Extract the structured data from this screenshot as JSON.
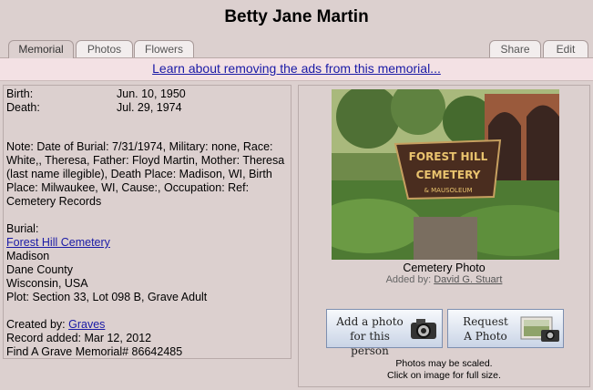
{
  "page": {
    "title": "Betty Jane Martin"
  },
  "tabs": [
    {
      "label": "Memorial"
    },
    {
      "label": "Photos"
    },
    {
      "label": "Flowers"
    },
    {
      "label": "Share"
    },
    {
      "label": "Edit"
    }
  ],
  "ad": {
    "link": "Learn about removing the ads from this memorial..."
  },
  "memorial": {
    "birth_label": "Birth:",
    "birth_date": "Jun. 10, 1950",
    "death_label": "Death:",
    "death_date": "Jul. 29, 1974",
    "note": "Note: Date of Burial: 7/31/1974, Military: none, Race: White,, Theresa, Father: Floyd Martin, Mother: Theresa (last name illegible), Death Place: Madison, WI, Birth Place: Milwaukee, WI, Cause:, Occupation: Ref: Cemetery Records",
    "burial_label": "Burial:",
    "cemetery_link": "Forest Hill Cemetery",
    "city": "Madison",
    "county": "Dane County",
    "state_country": "Wisconsin, USA",
    "plot": "Plot: Section 33, Lot 098 B, Grave Adult",
    "created_by_label": "Created by:",
    "created_by_link": "Graves",
    "record_added": "Record added: Mar 12, 2012",
    "memorial_id": "Find A Grave Memorial# 86642485"
  },
  "photo": {
    "sign_line1": "FOREST HILL",
    "sign_line2": "CEMETERY",
    "sign_line3": "& MAUSOLEUM",
    "caption": "Cemetery Photo",
    "added_by_label": "Added by:",
    "added_by_link": "David G. Stuart"
  },
  "buttons": {
    "add_photo_line1": "Add a photo",
    "add_photo_line2": "for this person",
    "request_line1": "Request",
    "request_line2": "A Photo"
  },
  "footer": {
    "line1": "Photos may be scaled.",
    "line2": "Click on image for full size."
  }
}
